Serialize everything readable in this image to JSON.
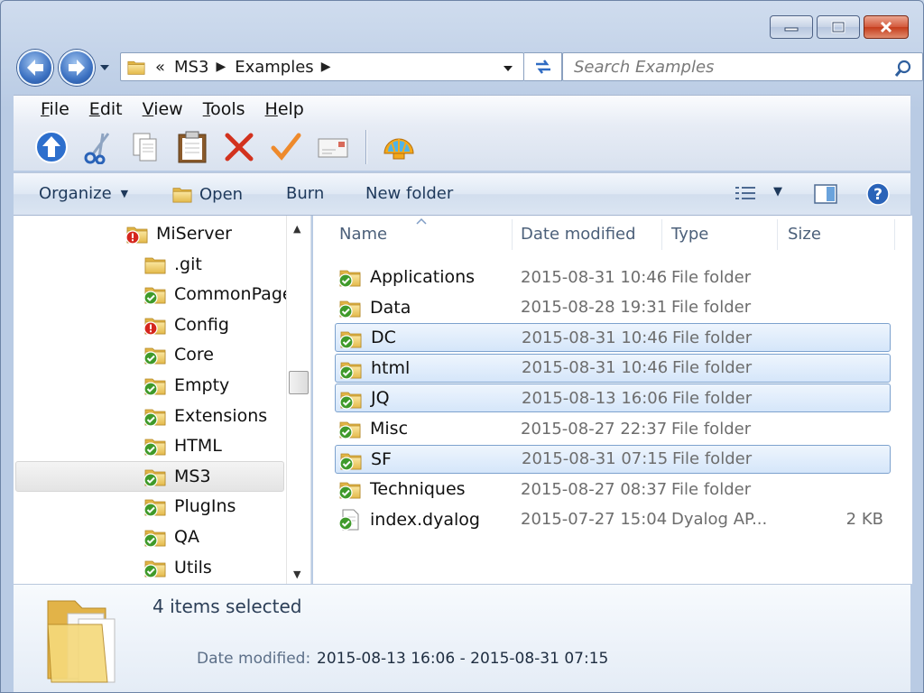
{
  "window": {
    "caption_buttons": [
      "minimize",
      "maximize",
      "close"
    ]
  },
  "address": {
    "overflow_glyph": "«",
    "segments": [
      "MS3",
      "Examples"
    ]
  },
  "search": {
    "placeholder": "Search Examples"
  },
  "menu": [
    {
      "label": "File",
      "accel": "F",
      "rest": "ile"
    },
    {
      "label": "Edit",
      "accel": "E",
      "rest": "dit"
    },
    {
      "label": "View",
      "accel": "V",
      "rest": "iew"
    },
    {
      "label": "Tools",
      "accel": "T",
      "rest": "ools"
    },
    {
      "label": "Help",
      "accel": "H",
      "rest": "elp"
    }
  ],
  "toolbar_icons": [
    "up-folder-icon",
    "cut-icon",
    "copy-icon",
    "paste-icon",
    "delete-icon",
    "checkmark-icon",
    "mail-icon",
    "shell-icon"
  ],
  "commands": {
    "organize": "Organize",
    "open": "Open",
    "burn": "Burn",
    "new_folder": "New folder"
  },
  "tree": [
    {
      "label": "MiServer",
      "icon": "error-folder"
    },
    {
      "label": ".git",
      "icon": "plain-folder"
    },
    {
      "label": "CommonPage",
      "icon": "ok-folder"
    },
    {
      "label": "Config",
      "icon": "error-folder"
    },
    {
      "label": "Core",
      "icon": "ok-folder"
    },
    {
      "label": "Empty",
      "icon": "ok-folder"
    },
    {
      "label": "Extensions",
      "icon": "ok-folder"
    },
    {
      "label": "HTML",
      "icon": "ok-folder"
    },
    {
      "label": "MS3",
      "icon": "ok-folder",
      "selected": true
    },
    {
      "label": "PlugIns",
      "icon": "ok-folder"
    },
    {
      "label": "QA",
      "icon": "ok-folder"
    },
    {
      "label": "Utils",
      "icon": "ok-folder"
    }
  ],
  "columns": {
    "name": "Name",
    "date": "Date modified",
    "type": "Type",
    "size": "Size"
  },
  "files": [
    {
      "name": "Applications",
      "date": "2015-08-31 10:46",
      "type": "File folder",
      "size": "",
      "selected": false,
      "icon": "ok-folder"
    },
    {
      "name": "Data",
      "date": "2015-08-28 19:31",
      "type": "File folder",
      "size": "",
      "selected": false,
      "icon": "ok-folder"
    },
    {
      "name": "DC",
      "date": "2015-08-31 10:46",
      "type": "File folder",
      "size": "",
      "selected": true,
      "icon": "ok-folder"
    },
    {
      "name": "html",
      "date": "2015-08-31 10:46",
      "type": "File folder",
      "size": "",
      "selected": true,
      "icon": "ok-folder"
    },
    {
      "name": "JQ",
      "date": "2015-08-13 16:06",
      "type": "File folder",
      "size": "",
      "selected": true,
      "icon": "ok-folder"
    },
    {
      "name": "Misc",
      "date": "2015-08-27 22:37",
      "type": "File folder",
      "size": "",
      "selected": false,
      "icon": "ok-folder"
    },
    {
      "name": "SF",
      "date": "2015-08-31 07:15",
      "type": "File folder",
      "size": "",
      "selected": true,
      "icon": "ok-folder"
    },
    {
      "name": "Techniques",
      "date": "2015-08-27 08:37",
      "type": "File folder",
      "size": "",
      "selected": false,
      "icon": "ok-folder"
    },
    {
      "name": "index.dyalog",
      "date": "2015-07-27 15:04",
      "type": "Dyalog AP...",
      "size": "2 KB",
      "selected": false,
      "icon": "file"
    }
  ],
  "details": {
    "count": "4 items selected",
    "date_label": "Date modified:",
    "date_value": "2015-08-13 16:06 - 2015-08-31 07:15"
  },
  "colors": {
    "selection_fill": "#d5e6fa",
    "selection_border": "#7da2ce",
    "command_text": "#1e395b",
    "folder_yellow": "#f3d36b",
    "overlay_green": "#3f9a2a",
    "overlay_red": "#d5261d"
  }
}
